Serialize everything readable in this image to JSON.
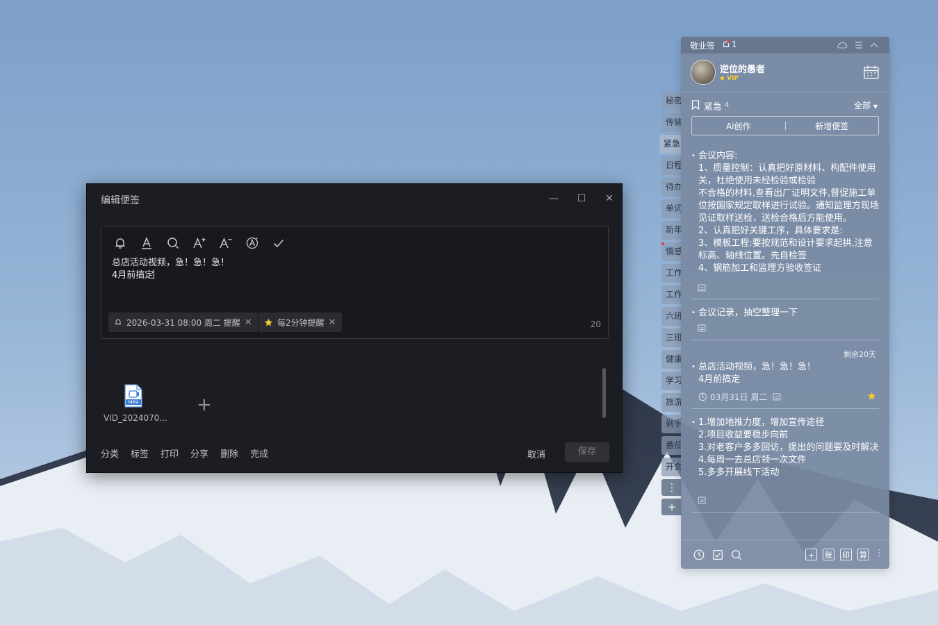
{
  "dialog": {
    "title": "编辑便签",
    "window_controls": {
      "minimize": "—",
      "maximize": "☐",
      "close": "✕"
    },
    "toolbar": [
      "bell-icon",
      "text-color-icon",
      "search-icon",
      "font-increase-icon",
      "font-decrease-icon",
      "clear-format-icon",
      "check-icon"
    ],
    "note_lines": [
      "总店活动视频，急！急！急！",
      "4月前搞定"
    ],
    "reminder_tag": "2026-03-31 08:00 周二 提醒",
    "repeat_tag": "每2分钟提醒",
    "char_count": "20",
    "attachment": {
      "name": "VID_2024070...",
      "badge": "MP4"
    },
    "add_attachment": "+",
    "footer": {
      "category": "分类",
      "tags": "标签",
      "print": "打印",
      "share": "分享",
      "delete": "删除",
      "done": "完成"
    },
    "cancel": "取消",
    "save": "保存"
  },
  "side_tabs": [
    {
      "label": "秘密",
      "active": false
    },
    {
      "label": "传输",
      "active": false
    },
    {
      "label": "紧急",
      "active": true
    },
    {
      "label": "日程",
      "active": false
    },
    {
      "label": "待办",
      "active": false
    },
    {
      "label": "单词",
      "active": false
    },
    {
      "label": "新年",
      "active": false
    },
    {
      "label": "情感",
      "active": false
    },
    {
      "label": "工作",
      "active": false
    },
    {
      "label": "工作",
      "active": false
    },
    {
      "label": "六班",
      "active": false
    },
    {
      "label": "三班",
      "active": false
    },
    {
      "label": "健康",
      "active": false
    },
    {
      "label": "学习",
      "active": false
    },
    {
      "label": "旅游",
      "active": false
    },
    {
      "label": "剁手",
      "active": false
    },
    {
      "label": "番茄",
      "active": false
    },
    {
      "label": "开会",
      "active": false
    }
  ],
  "side_buttons": {
    "more": "⋮",
    "add": "+"
  },
  "panel": {
    "app_name": "敬业签",
    "bell_count": "1",
    "user": {
      "name": "逆位的愚者",
      "badge": "VIP"
    },
    "category": {
      "name": "紧急",
      "count": "4"
    },
    "filter": "全部",
    "actions": {
      "ai": "Ai创作",
      "new_note": "新增便签"
    },
    "notes": [
      {
        "text": "会议内容:\n1、质量控制：认真把好原材料、构配件使用关，杜绝使用未经检验或检验\n不合格的材料,查看出厂证明文件,督促施工单位按国家规定取样进行试验。通知监理方现场见证取样送检，送检合格后方能使用。\n2、认真把好关键工序，具体要求是:\n3、模板工程:要按规范和设计要求起拱,注意标高、轴线位置。先自检签\n4、钢筋加工和监理方验收签证"
      },
      {
        "text": "会议记录，抽空整理一下"
      },
      {
        "text": "总店活动视频，急！急！急！\n4月前搞定",
        "remain": "剩余20天",
        "date": "03月31日 周二"
      },
      {
        "text": "1.增加地推力度，增加宣传途径\n2.项目收益要稳步向前\n3.对老客户多多回访，提出的问题要及时解决\n4.每周一去总店领一次文件\n5.多多开展线下活动"
      }
    ],
    "bottom": {
      "add": "+",
      "ledger": "账",
      "print": "印",
      "calc": "算"
    }
  },
  "colors": {
    "dialog_bg": "#1c1d22",
    "panel_bg": "#7a8aa2",
    "star": "#f2cd2f",
    "alert_dot": "#e04040"
  }
}
